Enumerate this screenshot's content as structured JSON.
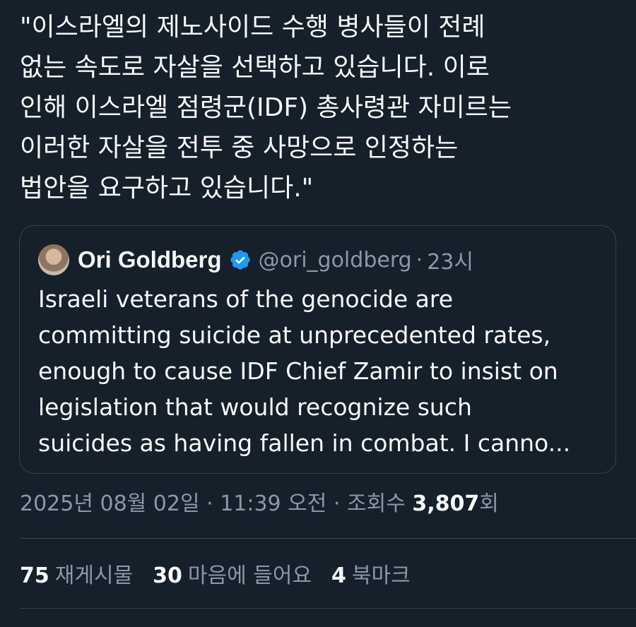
{
  "tweet": {
    "text": "\"이스라엘의 제노사이드 수행 병사들이 전례\n없는 속도로 자살을 선택하고 있습니다. 이로\n인해 이스라엘 점령군(IDF) 총사령관 자미르는\n이러한 자살을 전투 중 사망으로 인정하는\n법안을 요구하고 있습니다.\""
  },
  "quote": {
    "author_name": "Ori Goldberg",
    "handle": "@ori_goldberg",
    "separator": "·",
    "time": "23시",
    "text": "Israeli veterans of the genocide are\ncommitting suicide at unprecedented rates,\nenough to cause IDF Chief Zamir to insist on\nlegislation that would recognize such\nsuicides as having fallen in combat. I canno...",
    "icons": {
      "verified": "verified-badge-icon",
      "avatar": "avatar"
    }
  },
  "meta": {
    "date": "2025년 08월 02일",
    "separator1": " · ",
    "time": "11:39 오전",
    "separator2": " · ",
    "views_label": "조회수 ",
    "views_count": "3,807",
    "views_suffix": "회"
  },
  "stats": {
    "reposts_count": "75",
    "reposts_label": "재게시물",
    "likes_count": "30",
    "likes_label": "마음에 들어요",
    "bookmarks_count": "4",
    "bookmarks_label": "북마크"
  },
  "colors": {
    "background": "#15202b",
    "text": "#f7f9f9",
    "secondary": "#8b98a5",
    "border": "#38444d",
    "verified": "#1d9bf0"
  }
}
